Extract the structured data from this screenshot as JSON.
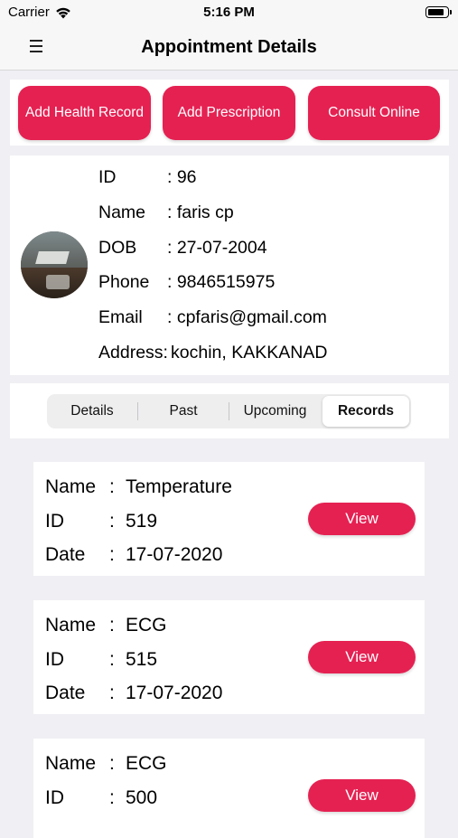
{
  "status_bar": {
    "carrier": "Carrier",
    "time": "5:16 PM"
  },
  "nav": {
    "title": "Appointment Details"
  },
  "actions": {
    "add_health_record": "Add Health Record",
    "add_prescription": "Add Prescription",
    "consult_online": "Consult Online"
  },
  "patient": {
    "rows": [
      {
        "label": "ID",
        "value": ": 96"
      },
      {
        "label": "Name",
        "value": ": faris cp"
      },
      {
        "label": "DOB",
        "value": ": 27-07-2004"
      },
      {
        "label": "Phone",
        "value": ": 9846515975"
      },
      {
        "label": "Email",
        "value": ": cpfaris@gmail.com"
      },
      {
        "label": "Address:",
        "value": "kochin, KAKKANAD"
      }
    ]
  },
  "tabs": [
    {
      "label": "Details"
    },
    {
      "label": "Past"
    },
    {
      "label": "Upcoming"
    },
    {
      "label": "Records",
      "selected": true
    }
  ],
  "records": [
    {
      "name_label": "Name",
      "name": "Temperature",
      "id_label": "ID",
      "id": "519",
      "date_label": "Date",
      "date": "17-07-2020",
      "button": "View"
    },
    {
      "name_label": "Name",
      "name": "ECG",
      "id_label": "ID",
      "id": "515",
      "date_label": "Date",
      "date": "17-07-2020",
      "button": "View"
    },
    {
      "name_label": "Name",
      "name": "ECG",
      "id_label": "ID",
      "id": "500",
      "button": "View"
    }
  ],
  "colors": {
    "accent": "#e52152",
    "background": "#efeff4",
    "bar": "#f7f7f7"
  },
  "icons": {
    "menu": "hamburger-menu-icon",
    "wifi": "wifi-icon",
    "battery": "battery-icon"
  }
}
